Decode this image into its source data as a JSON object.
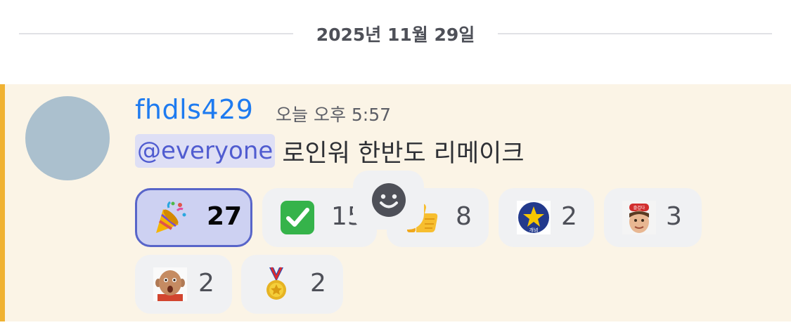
{
  "divider": {
    "date": "2025년 11월 29일"
  },
  "message": {
    "username": "fhdls429",
    "timestamp": "오늘 오후 5:57",
    "mention": "@everyone",
    "text": "로인워 한반도 리메이크"
  },
  "reactions": [
    {
      "icon": "party-popper-icon",
      "count": "27",
      "selected": true
    },
    {
      "icon": "check-mark-button-icon",
      "count": "15",
      "selected": false
    },
    {
      "icon": "thumbs-up-icon",
      "count": "8",
      "selected": false
    },
    {
      "icon": "custom-star-badge-icon",
      "badge_text": "개념",
      "count": "2",
      "selected": false
    },
    {
      "icon": "custom-boy-photo-icon",
      "badge_text": "즐겁다",
      "count": "3",
      "selected": false
    },
    {
      "icon": "custom-surprised-kid-photo-icon",
      "count": "2",
      "selected": false
    },
    {
      "icon": "medal-icon",
      "count": "2",
      "selected": false
    }
  ],
  "add_reaction": {
    "icon": "smiley-add-reaction-icon"
  },
  "colors": {
    "accent_bar": "#f0b232",
    "highlight_bg": "#fbf4e6",
    "username": "#1e7bf0",
    "mention_bg": "#dedff5",
    "mention_text": "#505cd0",
    "selected_reaction_border": "#5865c9"
  }
}
